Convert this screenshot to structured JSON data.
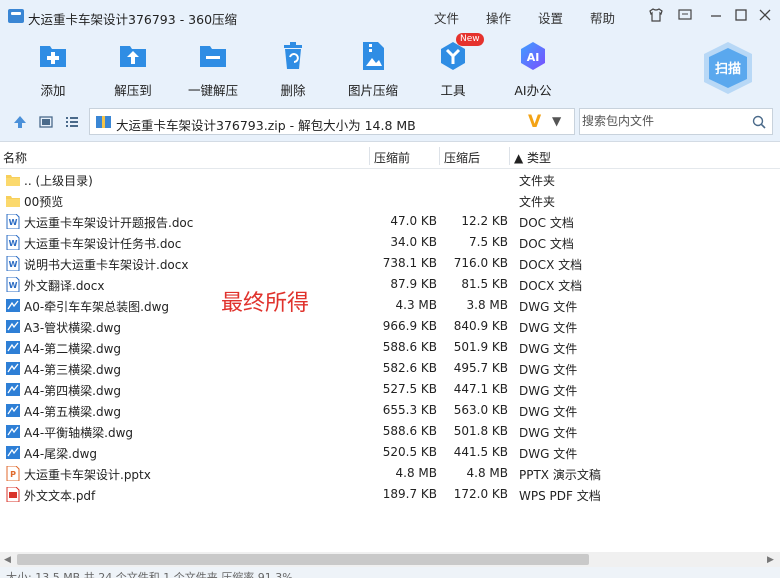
{
  "window": {
    "title": "大运重卡车架设计376793 - 360压缩",
    "menus": [
      "文件",
      "操作",
      "设置",
      "帮助"
    ]
  },
  "toolbar": {
    "items": [
      {
        "label": "添加",
        "icon": "add-icon"
      },
      {
        "label": "解压到",
        "icon": "extract-to-icon"
      },
      {
        "label": "一键解压",
        "icon": "one-click-extract-icon"
      },
      {
        "label": "删除",
        "icon": "delete-icon"
      },
      {
        "label": "图片压缩",
        "icon": "image-compress-icon"
      },
      {
        "label": "工具",
        "icon": "tools-icon"
      },
      {
        "label": "AI办公",
        "icon": "ai-office-icon"
      }
    ],
    "new_badge": "New",
    "ai_icon_text": "AI",
    "scan_label": "扫描"
  },
  "address": {
    "text": "大运重卡车架设计376793.zip - 解包大小为 14.8 MB",
    "logo_text": "V"
  },
  "search": {
    "placeholder": "搜索包内文件"
  },
  "columns": {
    "name": "名称",
    "packed": "压缩前",
    "compressed": "压缩后",
    "type": "▲ 类型"
  },
  "files": [
    {
      "name": ".. (上级目录)",
      "before": "",
      "after": "",
      "type": "文件夹",
      "kind": "folder"
    },
    {
      "name": "00预览",
      "before": "",
      "after": "",
      "type": "文件夹",
      "kind": "folder"
    },
    {
      "name": "大运重卡车架设计开题报告.doc",
      "before": "47.0 KB",
      "after": "12.2 KB",
      "type": "DOC 文档",
      "kind": "doc"
    },
    {
      "name": "大运重卡车架设计任务书.doc",
      "before": "34.0 KB",
      "after": "7.5 KB",
      "type": "DOC 文档",
      "kind": "doc"
    },
    {
      "name": "说明书大运重卡车架设计.docx",
      "before": "738.1 KB",
      "after": "716.0 KB",
      "type": "DOCX 文档",
      "kind": "doc"
    },
    {
      "name": "外文翻译.docx",
      "before": "87.9 KB",
      "after": "81.5 KB",
      "type": "DOCX 文档",
      "kind": "doc"
    },
    {
      "name": "A0-牵引车车架总装图.dwg",
      "before": "4.3 MB",
      "after": "3.8 MB",
      "type": "DWG 文件",
      "kind": "dwg"
    },
    {
      "name": "A3-管状横梁.dwg",
      "before": "966.9 KB",
      "after": "840.9 KB",
      "type": "DWG 文件",
      "kind": "dwg"
    },
    {
      "name": "A4-第二横梁.dwg",
      "before": "588.6 KB",
      "after": "501.9 KB",
      "type": "DWG 文件",
      "kind": "dwg"
    },
    {
      "name": "A4-第三横梁.dwg",
      "before": "582.6 KB",
      "after": "495.7 KB",
      "type": "DWG 文件",
      "kind": "dwg"
    },
    {
      "name": "A4-第四横梁.dwg",
      "before": "527.5 KB",
      "after": "447.1 KB",
      "type": "DWG 文件",
      "kind": "dwg"
    },
    {
      "name": "A4-第五横梁.dwg",
      "before": "655.3 KB",
      "after": "563.0 KB",
      "type": "DWG 文件",
      "kind": "dwg"
    },
    {
      "name": "A4-平衡轴横梁.dwg",
      "before": "588.6 KB",
      "after": "501.8 KB",
      "type": "DWG 文件",
      "kind": "dwg"
    },
    {
      "name": "A4-尾梁.dwg",
      "before": "520.5 KB",
      "after": "441.5 KB",
      "type": "DWG 文件",
      "kind": "dwg"
    },
    {
      "name": "大运重卡车架设计.pptx",
      "before": "4.8 MB",
      "after": "4.8 MB",
      "type": "PPTX 演示文稿",
      "kind": "pptx"
    },
    {
      "name": "外文文本.pdf",
      "before": "189.7 KB",
      "after": "172.0 KB",
      "type": "WPS PDF 文档",
      "kind": "pdf"
    }
  ],
  "overlay_note": "最终所得",
  "status": {
    "text": "大小: 13.5 MB 共 24 个文件和 1 个文件夹 压缩率 91.3%"
  },
  "colors": {
    "toolbar_bg": "#e8f1fb",
    "accent_blue": "#2f8de4",
    "note_red": "#e0322c"
  }
}
